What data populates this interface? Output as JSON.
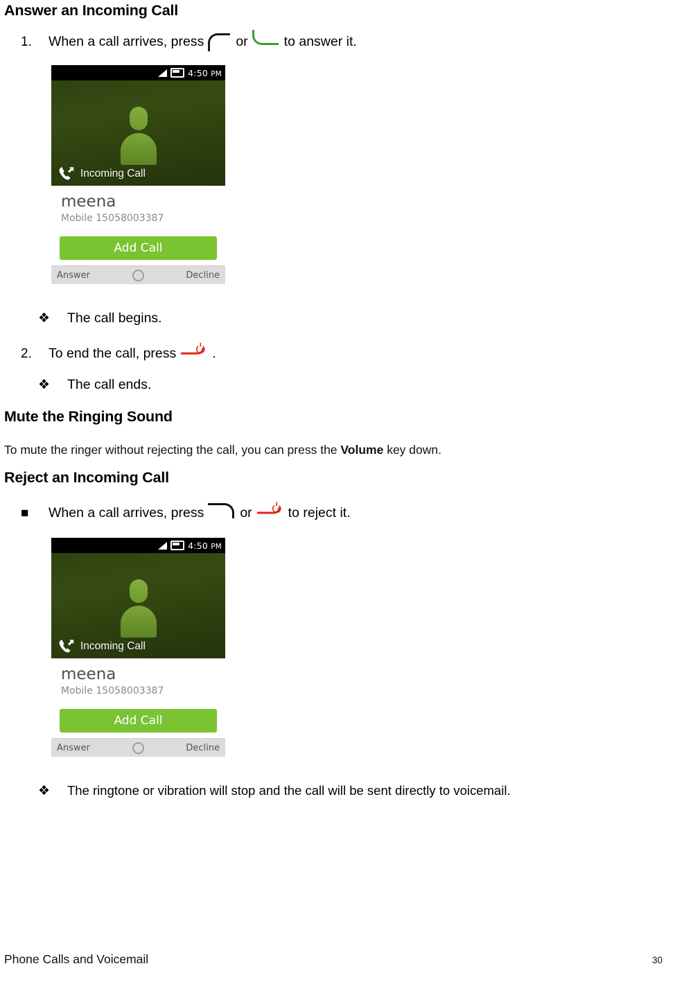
{
  "sections": {
    "answer_heading": "Answer an Incoming Call",
    "mute_heading": "Mute the Ringing Sound",
    "mute_paragraph_before": "To mute the ringer without rejecting the call, you can press the ",
    "mute_paragraph_bold": "Volume",
    "mute_paragraph_after": " key down.",
    "reject_heading": "Reject an Incoming Call"
  },
  "steps": {
    "step1_number": "1.",
    "step1_text_before": "When a call arrives, press",
    "step1_text_or": "or",
    "step1_text_after": "to answer it.",
    "result1_marker": "❖",
    "result1_text": "The call begins.",
    "step2_number": "2.",
    "step2_text_before": "To end the call, press",
    "step2_text_after": ".",
    "result2_marker": "❖",
    "result2_text": "The call ends.",
    "reject_marker": "■",
    "reject_text_before": "When a call arrives, press",
    "reject_text_or": "or",
    "reject_text_after": "to reject it.",
    "reject_result_marker": "❖",
    "reject_result_text": "The ringtone or vibration will stop and the call will be sent directly to voicemail."
  },
  "icons": {
    "send_key_black": "send-key-icon",
    "send_key_green": "answer-key-icon",
    "end_key_black": "end-key-icon",
    "end_key_red": "power-end-key-icon"
  },
  "phone_screenshot": {
    "status_time": "4:50",
    "status_ampm": "PM",
    "signal_icon": "signal-bars-icon",
    "battery_icon": "battery-icon",
    "call_state_label": "Incoming Call",
    "call_state_icon": "outgoing-call-handset-icon",
    "avatar_icon": "contact-avatar-icon",
    "contact_name": "meena",
    "contact_number": "Mobile 15058003387",
    "add_call_label": "Add Call",
    "answer_label": "Answer",
    "home_icon": "home-circle-icon",
    "decline_label": "Decline"
  },
  "footer": {
    "chapter": "Phone Calls and Voicemail",
    "page_number": "30"
  },
  "colors": {
    "answer_green": "#3f9c35",
    "end_red": "#e1261c",
    "add_call_green": "#7ac332",
    "status_bar_black": "#000000",
    "hero_green": "#334612"
  }
}
